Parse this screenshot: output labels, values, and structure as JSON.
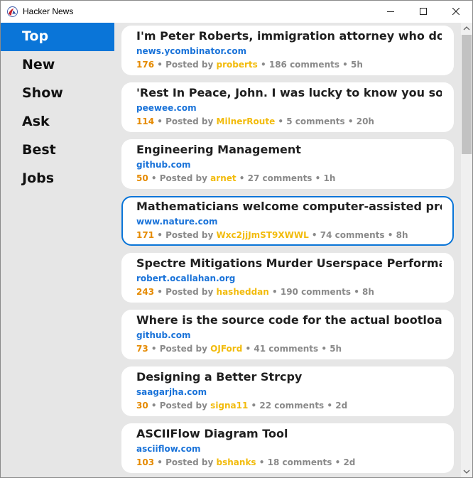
{
  "window": {
    "title": "Hacker News"
  },
  "nav": {
    "items": [
      {
        "label": "Top",
        "active": true
      },
      {
        "label": "New",
        "active": false
      },
      {
        "label": "Show",
        "active": false
      },
      {
        "label": "Ask",
        "active": false
      },
      {
        "label": "Best",
        "active": false
      },
      {
        "label": "Jobs",
        "active": false
      }
    ]
  },
  "stories": [
    {
      "title": "I'm Peter Roberts, immigration attorney who does work for YC and startups. AMA",
      "domain": "news.ycombinator.com",
      "score": "176",
      "posted_by": "Posted by",
      "user": "proberts",
      "comments": "186 comments",
      "age": "5h"
    },
    {
      "title": "'Rest In Peace, John. I was lucky to know you so deeply' – Brian Eno",
      "domain": "peewee.com",
      "score": "114",
      "posted_by": "Posted by",
      "user": "MilnerRoute",
      "comments": "5 comments",
      "age": "20h"
    },
    {
      "title": "Engineering Management",
      "domain": "github.com",
      "score": "50",
      "posted_by": "Posted by",
      "user": "arnet",
      "comments": "27 comments",
      "age": "1h"
    },
    {
      "title": "Mathematicians welcome computer-assisted proof in ‘grand unification’ theory",
      "domain": "www.nature.com",
      "score": "171",
      "posted_by": "Posted by",
      "user": "Wxc2jjJmST9XWWL",
      "comments": "74 comments",
      "age": "8h"
    },
    {
      "title": "Spectre Mitigations Murder Userspace Performance",
      "domain": "robert.ocallahan.org",
      "score": "243",
      "posted_by": "Posted by",
      "user": "hasheddan",
      "comments": "190 comments",
      "age": "8h"
    },
    {
      "title": "Where is the source code for the actual bootloader shipped on devices?",
      "domain": "github.com",
      "score": "73",
      "posted_by": "Posted by",
      "user": "OJFord",
      "comments": "41 comments",
      "age": "5h"
    },
    {
      "title": "Designing a Better Strcpy",
      "domain": "saagarjha.com",
      "score": "30",
      "posted_by": "Posted by",
      "user": "signa11",
      "comments": "22 comments",
      "age": "2d"
    },
    {
      "title": "ASCIIFlow Diagram Tool",
      "domain": "asciiflow.com",
      "score": "103",
      "posted_by": "Posted by",
      "user": "bshanks",
      "comments": "18 comments",
      "age": "2d"
    }
  ],
  "focused_story_index": 3,
  "separator": "•",
  "colors": {
    "accent": "#0a75d8",
    "domain": "#1a73d9",
    "score": "#e58a00",
    "user": "#f2bb0c",
    "meta": "#8a8a8a",
    "background": "#e6e6e6"
  },
  "icons": {
    "app": "racket-logo-icon",
    "minimize": "minimize-icon",
    "maximize": "maximize-icon",
    "close": "close-icon"
  }
}
